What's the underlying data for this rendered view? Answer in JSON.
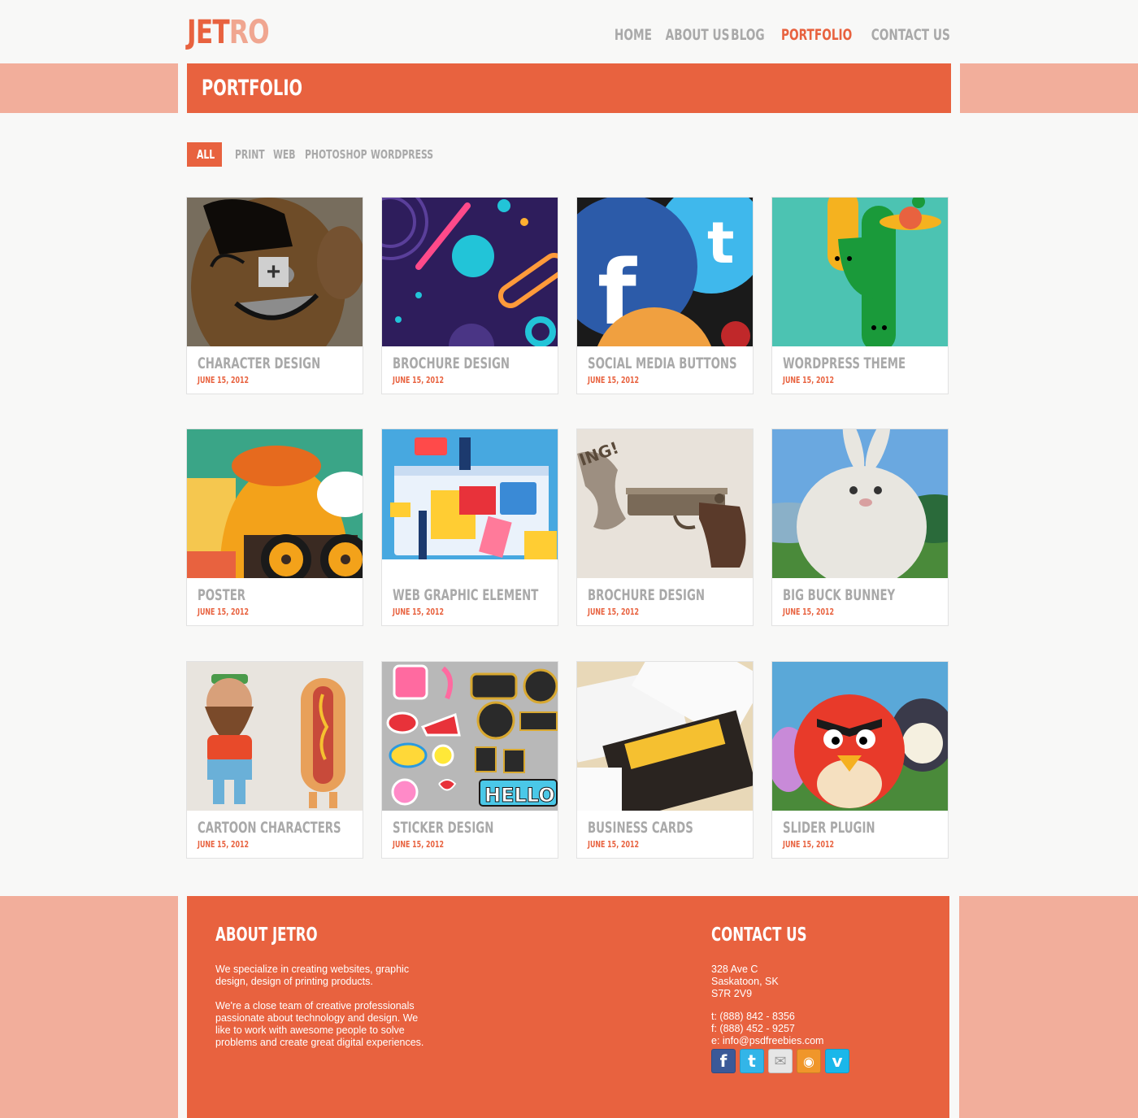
{
  "brand": {
    "part1": "JET",
    "part2": "RO"
  },
  "nav": [
    {
      "label": "HOME",
      "active": false
    },
    {
      "label": "ABOUT US",
      "active": false
    },
    {
      "label": "BLOG",
      "active": false
    },
    {
      "label": "PORTFOLIO",
      "active": true
    },
    {
      "label": "CONTACT US",
      "active": false
    }
  ],
  "page_title": "PORTFOLIO",
  "filters": [
    {
      "label": "ALL",
      "active": true
    },
    {
      "label": "PRINT",
      "active": false
    },
    {
      "label": "WEB",
      "active": false
    },
    {
      "label": "PHOTOSHOP",
      "active": false
    },
    {
      "label": "WORDPRESS",
      "active": false
    }
  ],
  "items": [
    {
      "title": "CHARACTER DESIGN",
      "date": "JUNE 15, 2012",
      "icon": "cartoon-face-thumbnail"
    },
    {
      "title": "BROCHURE DESIGN",
      "date": "JUNE 15, 2012",
      "icon": "abstract-shapes-thumbnail"
    },
    {
      "title": "SOCIAL MEDIA BUTTONS",
      "date": "JUNE 15, 2012",
      "icon": "social-buttons-thumbnail"
    },
    {
      "title": "WORDPRESS THEME",
      "date": "JUNE 15, 2012",
      "icon": "tall-creatures-thumbnail"
    },
    {
      "title": "POSTER",
      "date": "JUNE 15, 2012",
      "icon": "glasses-character-thumbnail"
    },
    {
      "title": "WEB GRAPHIC ELEMENT",
      "date": "JUNE 15, 2012",
      "icon": "web-graphic-thumbnail"
    },
    {
      "title": "BROCHURE DESIGN",
      "date": "JUNE 15, 2012",
      "icon": "pistol-thumbnail"
    },
    {
      "title": "BIG BUCK BUNNEY",
      "date": "JUNE 15, 2012",
      "icon": "bunny-thumbnail"
    },
    {
      "title": "CARTOON CHARACTERS",
      "date": "JUNE 15, 2012",
      "icon": "toy-figures-thumbnail"
    },
    {
      "title": "STICKER DESIGN",
      "date": "JUNE 15, 2012",
      "icon": "stickers-thumbnail"
    },
    {
      "title": "BUSINESS CARDS",
      "date": "JUNE 15, 2012",
      "icon": "business-cards-thumbnail"
    },
    {
      "title": "SLIDER PLUGIN",
      "date": "JUNE 15, 2012",
      "icon": "angry-birds-thumbnail"
    }
  ],
  "footer": {
    "about_title": "ABOUT JETRO",
    "about_p1": "We specialize in creating websites, graphic design, design of printing products.",
    "about_p2": "We're a close team of creative professionals passionate about technology and design. We like to work with awesome people to solve problems and create great digital experiences.",
    "contact_title": "CONTACT US",
    "address": [
      "328 Ave C",
      "Saskatoon, SK",
      "S7R 2V9"
    ],
    "phone": "t: (888) 842 - 8356",
    "fax": "f: (888) 452 - 9257",
    "email": "e: info@psdfreebies.com",
    "social": [
      {
        "name": "facebook-icon",
        "glyph": "f",
        "color": "#3b5998"
      },
      {
        "name": "twitter-icon",
        "glyph": "t",
        "color": "#33b5e8"
      },
      {
        "name": "mail-icon",
        "glyph": "✉",
        "color": "#e6e6e6"
      },
      {
        "name": "rss-icon",
        "glyph": "◉",
        "color": "#f0962a"
      },
      {
        "name": "vimeo-icon",
        "glyph": "v",
        "color": "#1ab7ea"
      }
    ]
  },
  "colors": {
    "accent": "#e8623f",
    "accent_light": "#f2ae9b",
    "muted_text": "#a9a9a9"
  }
}
